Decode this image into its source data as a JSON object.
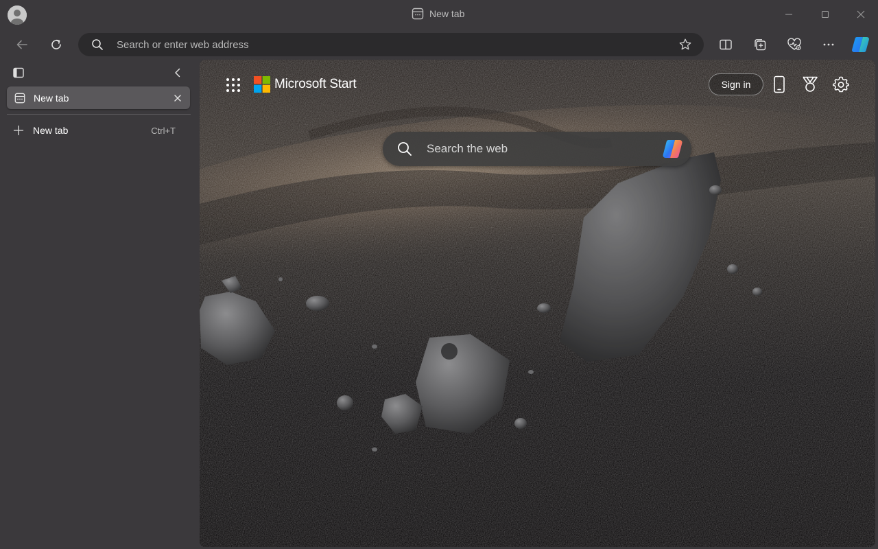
{
  "window": {
    "title": "New tab",
    "controls": [
      "minimize",
      "maximize",
      "close"
    ]
  },
  "toolbar": {
    "address_placeholder": "Search or enter web address",
    "icons": [
      "back-icon",
      "refresh-icon",
      "search-icon",
      "favorite-star-icon",
      "split-screen-icon",
      "collections-icon",
      "browser-essentials-icon",
      "more-icon",
      "copilot-icon"
    ]
  },
  "sidebar": {
    "active_tab": {
      "label": "New tab"
    },
    "new_tab": {
      "label": "New tab",
      "shortcut": "Ctrl+T"
    }
  },
  "page": {
    "brand": "Microsoft Start",
    "sign_in_label": "Sign in",
    "search_placeholder": "Search the web",
    "logo_colors": [
      "#f25022",
      "#7fba00",
      "#00a4ef",
      "#ffb900"
    ]
  },
  "colors": {
    "chrome_bg": "#3b393c",
    "address_bg": "#2b2a2c",
    "active_tab_bg": "#5a585b"
  }
}
